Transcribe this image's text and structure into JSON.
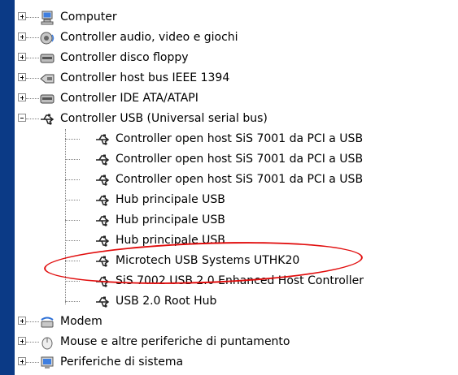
{
  "device_tree": {
    "items": [
      {
        "label": "Computer",
        "icon": "computer-icon",
        "expanded": false
      },
      {
        "label": "Controller audio, video e giochi",
        "icon": "audio-icon",
        "expanded": false
      },
      {
        "label": "Controller disco floppy",
        "icon": "floppy-controller-icon",
        "expanded": false
      },
      {
        "label": "Controller host bus IEEE 1394",
        "icon": "ieee1394-icon",
        "expanded": false
      },
      {
        "label": "Controller IDE ATA/ATAPI",
        "icon": "ide-controller-icon",
        "expanded": false
      },
      {
        "label": "Controller USB (Universal serial bus)",
        "icon": "usb-icon",
        "expanded": true,
        "children": [
          {
            "label": "Controller open host SiS 7001 da PCI a USB",
            "icon": "usb-icon"
          },
          {
            "label": "Controller open host SiS 7001 da PCI a USB",
            "icon": "usb-icon"
          },
          {
            "label": "Controller open host SiS 7001 da PCI a USB",
            "icon": "usb-icon"
          },
          {
            "label": "Hub principale USB",
            "icon": "usb-icon"
          },
          {
            "label": "Hub principale USB",
            "icon": "usb-icon"
          },
          {
            "label": "Hub principale USB",
            "icon": "usb-icon"
          },
          {
            "label": "Microtech USB Systems UTHK20",
            "icon": "usb-icon",
            "highlighted": true
          },
          {
            "label": "SiS 7002 USB 2.0 Enhanced Host Controller",
            "icon": "usb-icon"
          },
          {
            "label": "USB 2.0 Root Hub",
            "icon": "usb-icon"
          }
        ]
      },
      {
        "label": "Modem",
        "icon": "modem-icon",
        "expanded": false
      },
      {
        "label": "Mouse e altre periferiche di puntamento",
        "icon": "mouse-icon",
        "expanded": false
      },
      {
        "label": "Periferiche di sistema",
        "icon": "system-devices-icon",
        "expanded": false
      }
    ]
  },
  "colors": {
    "background": "#0b3a86",
    "panel": "#ffffff",
    "highlight_circle": "#e10d0d"
  }
}
